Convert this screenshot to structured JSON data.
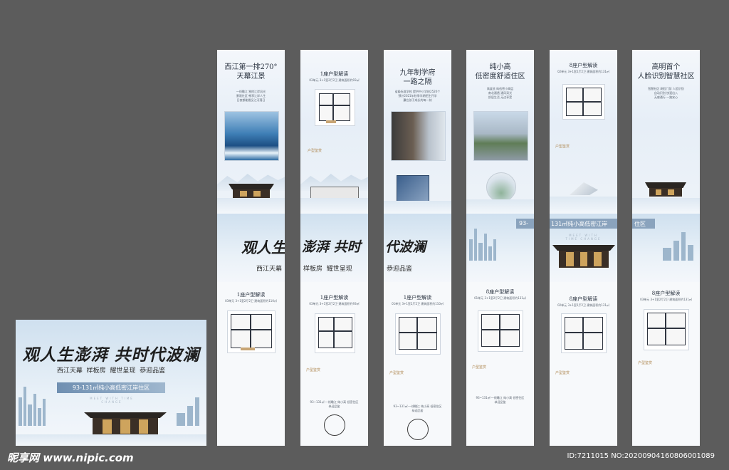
{
  "banner": {
    "headline": "观人生澎湃 共时代波澜",
    "subline": "西江天幕  样板房  耀世呈现  恭迎品鉴",
    "area_bar": "93-131㎡纯小高低密江岸住区",
    "watermark": "MEET WITH TIME CHANGE"
  },
  "panels": [
    {
      "title": "西江第一排270°\n天幕江景",
      "desc": "一线瞰江 独揽江岸风光\n景观社区 畅享江岸人生\n日夜都能看见江河落日"
    },
    {
      "title": "1座户型解读",
      "meta": "03单元  3+1室2厅2卫  建筑面积约93㎡"
    },
    {
      "title": "九年制学府\n一路之隔",
      "desc": "省级标准学校 提供中小学校2520个\n预计2021年秋季学期招生开学\n赢在孩子成长的每一刻"
    },
    {
      "title": "纯小高\n低密度舒适住区",
      "desc": "高度低 纯低密小高层\n南北通透 通风采光\n舒居生活 无边享受"
    },
    {
      "title": "8座户型解读",
      "meta": "02单元  3+1室2厅2卫  建筑面积约131㎡"
    },
    {
      "title": "高明首个\n人脸识别智慧社区",
      "desc": "智慧社区 刷脸门禁 人脸识别\n自动识别 快速出入\n无感通行 一路安心"
    }
  ],
  "middle_band": {
    "left": "观人生",
    "center": "澎湃 共时",
    "right": "代波澜",
    "sub_left": "西江天幕",
    "sub_center": "样板房  耀世呈现",
    "sub_right": "恭迎品鉴",
    "area_bar": "93-",
    "area_bar2": "131㎡纯小高低密江岸",
    "area_bar3": "住区",
    "watermark": "MEET WITH TIME CHANGE"
  },
  "lower_panels": [
    {
      "title": "1座户型解读",
      "meta": "03单元  3+1室2厅2卫  建筑面积约110㎡"
    },
    {
      "title": "1座户型解读",
      "meta": "03单元  3+1室2厅2卫  建筑面积约93㎡",
      "tag": "户型鉴赏",
      "foot": "93~131㎡·一线瞰江 纯小高 低密住区\n恭迎品鉴"
    },
    {
      "title": "1座户型解读",
      "meta": "01单元  3+1室2厅2卫  建筑面积约110㎡",
      "tag": "户型鉴赏",
      "foot": "93~131㎡·一线瞰江 纯小高 低密住区\n恭迎品鉴"
    },
    {
      "title": "8座户型解读",
      "meta": "01单元  3+1室2厅2卫  建筑面积约131㎡",
      "tag": "户型鉴赏",
      "foot": "93~131㎡·一线瞰江 纯小高 低密住区\n恭迎品鉴"
    },
    {
      "title": "8座户型解读",
      "meta": "02单元  3+1室2厅2卫  建筑面积约131㎡",
      "tag": "户型鉴赏"
    },
    {
      "title": "8座户型解读",
      "meta": "03单元  3+1室2厅2卫  建筑面积约131㎡",
      "tag": "户型鉴赏"
    }
  ],
  "upper_tags": [
    "户型鉴赏",
    "户型鉴赏"
  ],
  "footer": {
    "logo": "昵享网 www.nipic.com",
    "id": "ID:7211015 NO:20200904160806001089"
  },
  "colors": {
    "background": "#5c5c5c",
    "panel": "#eef3f8",
    "accent": "#b08a55",
    "headline": "#222222"
  }
}
